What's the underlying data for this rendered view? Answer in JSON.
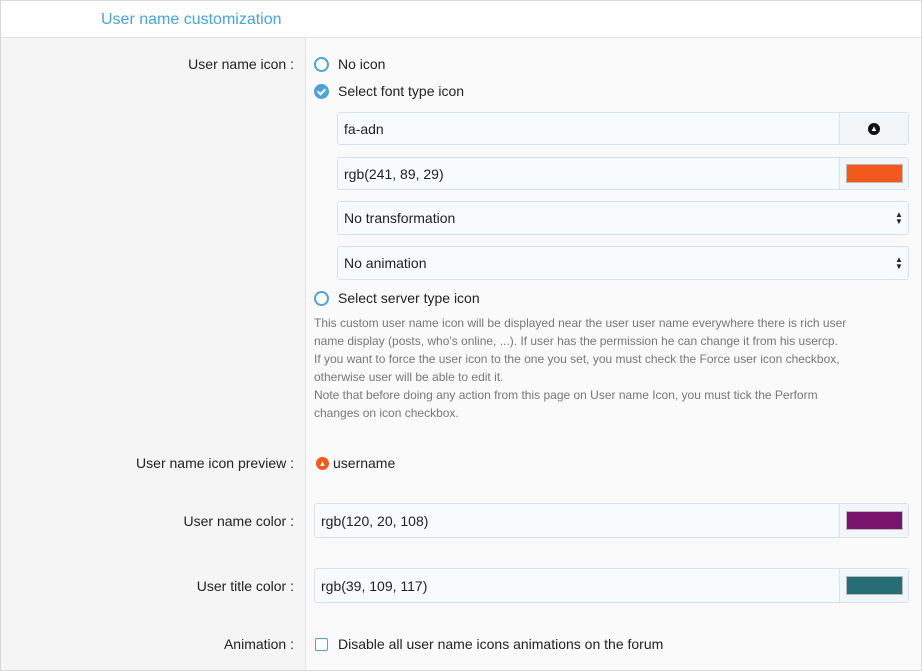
{
  "header": {
    "title": "User name customization"
  },
  "labels": {
    "icon": "User name icon :",
    "preview": "User name icon preview :",
    "name_color": "User name color :",
    "title_color": "User title color :",
    "animation": "Animation :"
  },
  "icon_options": {
    "no_icon": {
      "label": "No icon",
      "checked": false
    },
    "font_icon": {
      "label": "Select font type icon",
      "checked": true
    },
    "server_icon": {
      "label": "Select server type icon",
      "checked": false
    }
  },
  "font_icon": {
    "name": "fa-adn",
    "color": "rgb(241, 89, 29)",
    "transformation": "No transformation",
    "animation": "No animation"
  },
  "help_text": [
    "This custom user name icon will be displayed near the user user name everywhere there is rich user",
    "name display (posts, who's online, ...). If user has the permission he can change it from his usercp.",
    "If you want to force the user icon to the one you set, you must check the Force user icon checkbox,",
    "otherwise user will be able to edit it.",
    "Note that before doing any action from this page on User name Icon, you must tick the Perform",
    "changes on icon checkbox."
  ],
  "preview": {
    "username": "username"
  },
  "name_color": "rgb(120, 20, 108)",
  "title_color": "rgb(39, 109, 117)",
  "animation_checkbox": {
    "label": "Disable all user name icons animations on the forum",
    "checked": false
  },
  "colors": {
    "accent": "#47a4dc",
    "icon_color": "#f1591d",
    "name_color": "#78146c",
    "title_color": "#276d75"
  },
  "icons": {
    "font_icon_preview": "adn-icon",
    "user_icon_preview": "adn-icon"
  }
}
